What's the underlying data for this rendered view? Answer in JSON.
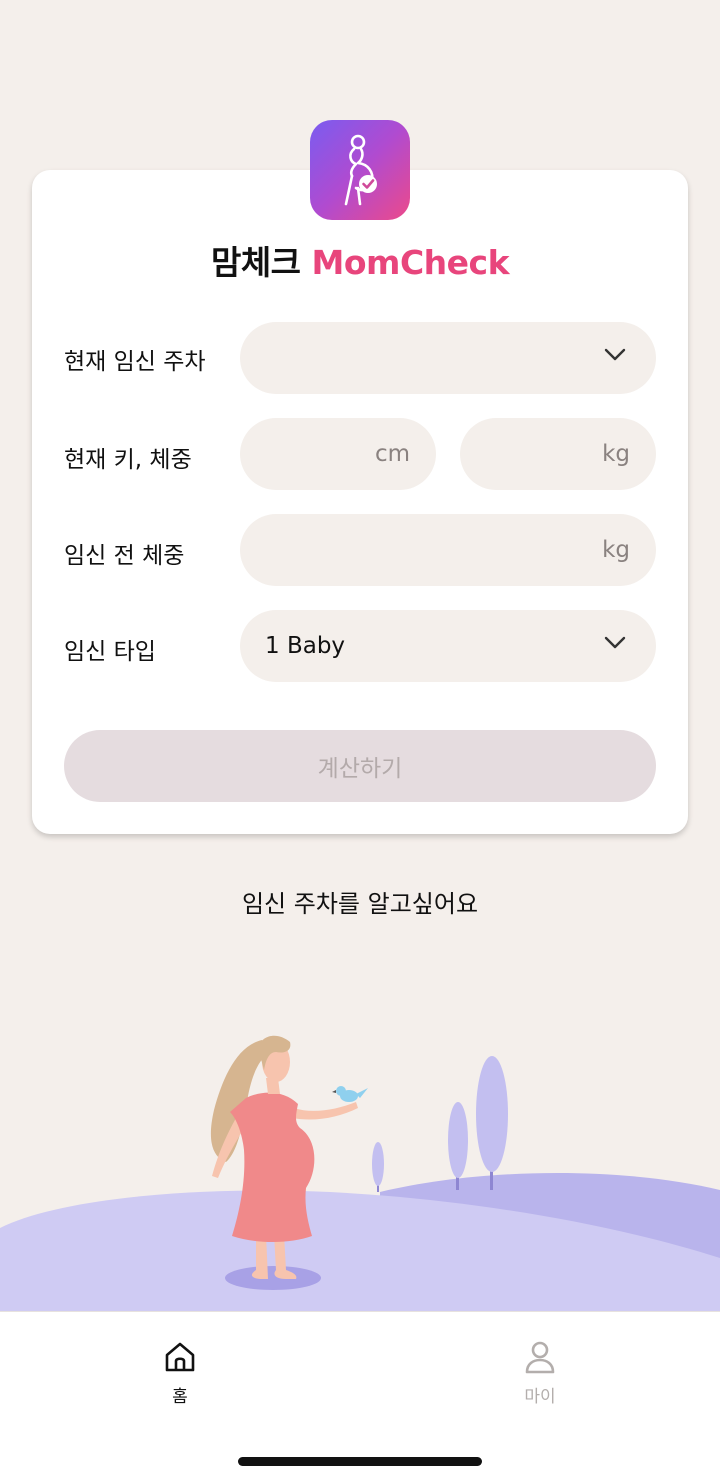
{
  "app": {
    "title_ko": "맘체크",
    "title_en": "MomCheck",
    "accent_color": "#e8457c",
    "icon": "pregnant-woman-check-icon"
  },
  "form": {
    "weeks": {
      "label": "현재 임신 주차",
      "value": ""
    },
    "height_weight": {
      "label": "현재 키, 체중",
      "height_unit": "cm",
      "weight_unit": "kg"
    },
    "pre_weight": {
      "label": "임신 전 체중",
      "unit": "kg"
    },
    "type": {
      "label": "임신 타입",
      "value": "1 Baby"
    },
    "submit_label": "계산하기"
  },
  "question": "임신 주차를 알고싶어요",
  "tabbar": {
    "items": [
      {
        "label": "홈",
        "icon": "home-icon",
        "active": true
      },
      {
        "label": "마이",
        "icon": "person-icon",
        "active": false
      }
    ]
  }
}
